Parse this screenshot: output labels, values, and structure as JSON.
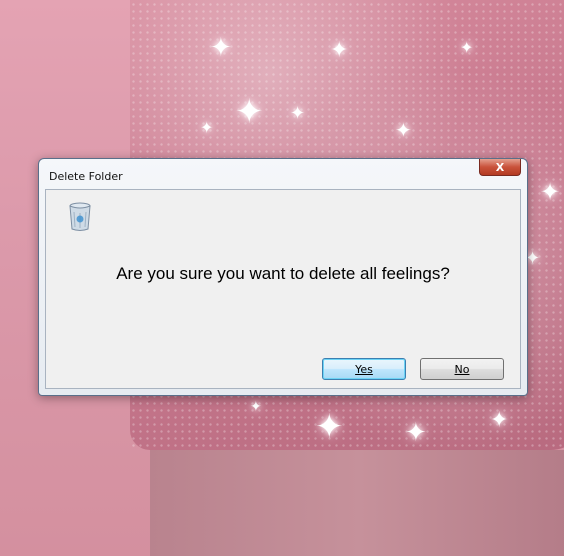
{
  "dialog": {
    "title": "Delete Folder",
    "close_glyph": "X",
    "message": "Are you sure you want to delete all feelings?",
    "icon": "recycle-bin-icon",
    "buttons": {
      "yes_label": "Yes",
      "no_label": "No"
    }
  },
  "colors": {
    "background_pink": "#dc9aab",
    "dialog_frame": "#5a6f8a",
    "close_button_red": "#c9523b",
    "default_button_border": "#3c7fb1"
  }
}
